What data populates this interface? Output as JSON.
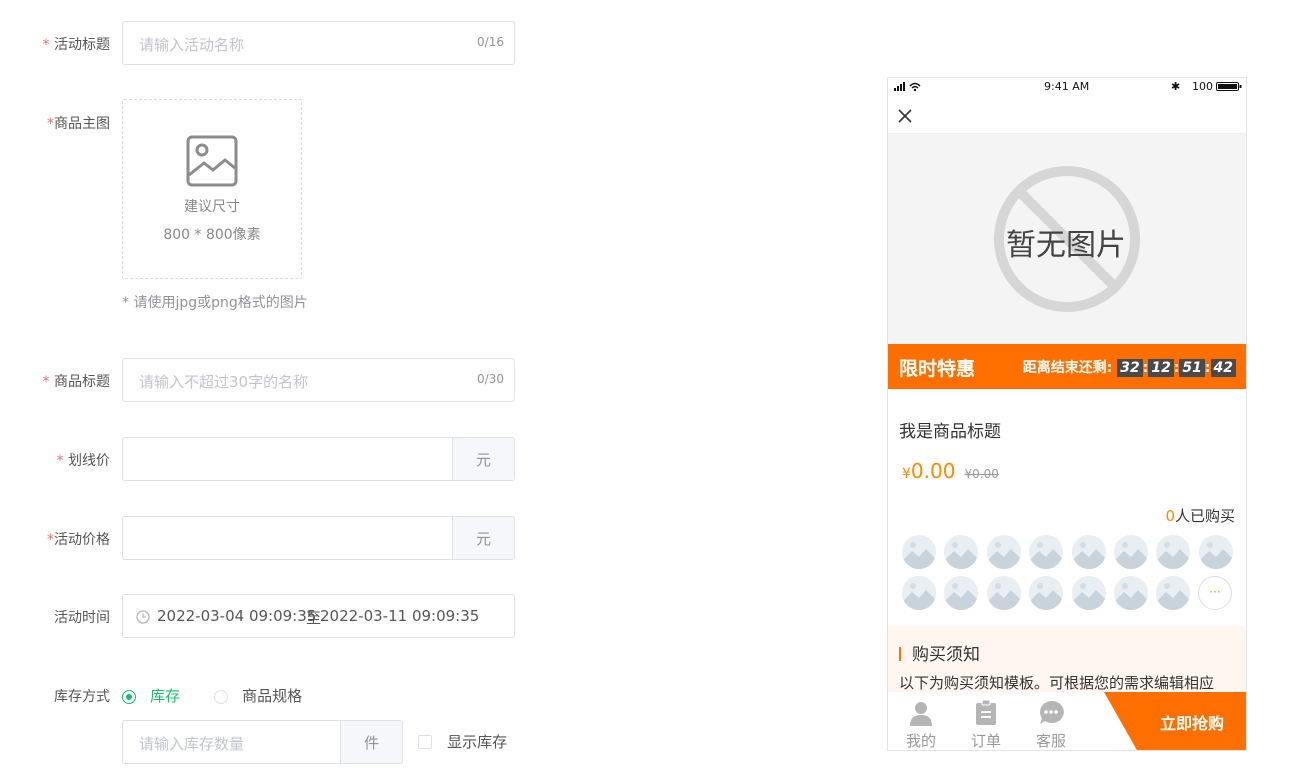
{
  "form": {
    "required_mark": "*",
    "activity_title": {
      "label": "活动标题",
      "placeholder": "请输入活动名称",
      "count": "0/16"
    },
    "main_image": {
      "label": "商品主图",
      "hint_line1": "建议尺寸",
      "hint_line2": "800 * 800像素",
      "note": "* 请使用jpg或png格式的图片"
    },
    "product_title": {
      "label": "商品标题",
      "placeholder": "请输入不超过30字的名称",
      "count": "0/30"
    },
    "strike_price": {
      "label": "划线价",
      "unit": "元"
    },
    "activity_price": {
      "label": "活动价格",
      "unit": "元"
    },
    "activity_time": {
      "label": "活动时间",
      "start": "2022-03-04 09:09:35",
      "separator": "至",
      "end": "2022-03-11 09:09:35"
    },
    "stock_mode": {
      "label": "库存方式",
      "option_stock": "库存",
      "option_spec": "商品规格",
      "selected": "库存"
    },
    "stock_qty": {
      "placeholder": "请输入库存数量",
      "unit": "件",
      "show_stock_label": "显示库存"
    }
  },
  "preview": {
    "status": {
      "time": "9:41 AM",
      "battery": "100"
    },
    "close_icon": "close-icon",
    "no_image_text": "暂无图片",
    "promo": {
      "title": "限时特惠",
      "countdown_label": "距离结束还剩:",
      "h": "32",
      "m": "12",
      "s": "51",
      "ms": "42"
    },
    "product_title": "我是商品标题",
    "price": {
      "currency": "¥",
      "value": "0.00",
      "original": "¥0.00"
    },
    "buyers": {
      "count": "0",
      "suffix": "人已购买"
    },
    "more": "···",
    "notice": {
      "title": "购买须知",
      "text": "以下为购买须知模板。可根据您的需求编辑相应"
    },
    "tabs": [
      {
        "label": "我的",
        "icon": "user-icon"
      },
      {
        "label": "订单",
        "icon": "clipboard-icon"
      },
      {
        "label": "客服",
        "icon": "chat-icon"
      }
    ],
    "buy_button": "立即抢购"
  },
  "colors": {
    "accent": "#ff6f00",
    "required": "#f56c6c",
    "success": "#19be6b"
  }
}
